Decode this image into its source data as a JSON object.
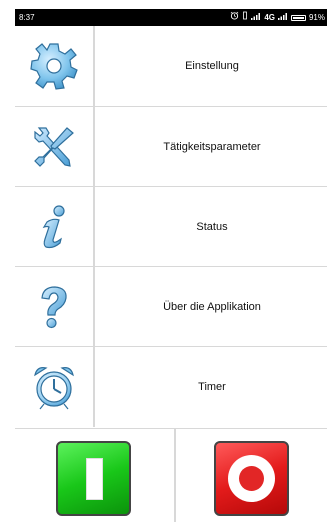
{
  "status_bar": {
    "time": "8:37",
    "network": "4G",
    "battery": "91%",
    "battery_level": 0.91
  },
  "menu": {
    "items": [
      {
        "label": "Einstellung",
        "icon": "gear-icon"
      },
      {
        "label": "Tätigkeitsparameter",
        "icon": "tools-icon"
      },
      {
        "label": "Status",
        "icon": "info-icon"
      },
      {
        "label": "Über die Applikation",
        "icon": "help-icon"
      },
      {
        "label": "Timer",
        "icon": "alarm-clock-icon"
      }
    ]
  },
  "controls": {
    "start_icon": "start-icon",
    "stop_icon": "stop-icon"
  },
  "colors": {
    "icon_blue": "#7fc4ec",
    "icon_stroke": "#2f6f9c",
    "start_green": "#19c719",
    "stop_red": "#e31b1b",
    "divider": "#d8d8d8"
  }
}
